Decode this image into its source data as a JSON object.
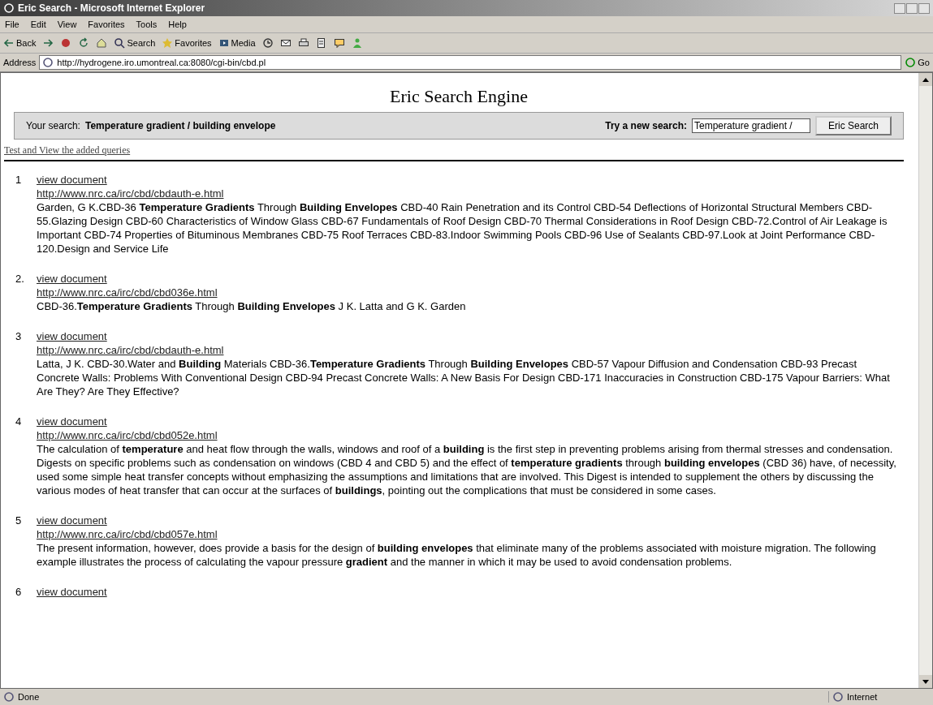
{
  "window": {
    "title": "Eric Search - Microsoft Internet Explorer"
  },
  "menu": [
    "File",
    "Edit",
    "View",
    "Favorites",
    "Tools",
    "Help"
  ],
  "toolbar": [
    {
      "kind": "back",
      "label": "Back"
    },
    {
      "kind": "forward"
    },
    {
      "kind": "stop"
    },
    {
      "kind": "refresh"
    },
    {
      "kind": "home"
    },
    {
      "kind": "search",
      "label": "Search"
    },
    {
      "kind": "favorites",
      "label": "Favorites"
    },
    {
      "kind": "media",
      "label": "Media"
    },
    {
      "kind": "history"
    },
    {
      "kind": "mail"
    },
    {
      "kind": "print"
    },
    {
      "kind": "edit"
    },
    {
      "kind": "discuss"
    },
    {
      "kind": "messenger"
    }
  ],
  "address": {
    "label": "Address",
    "value": "http://hydrogene.iro.umontreal.ca:8080/cgi-bin/cbd.pl",
    "go": "Go"
  },
  "page": {
    "heading": "Eric Search Engine",
    "search_bar": {
      "label": "Your search:",
      "query": "Temperature gradient / building envelope",
      "new_label": "Try a new search:",
      "field_value": "Temperature gradient /",
      "button": "Eric Search"
    },
    "test_link": "Test and View the added queries",
    "results": [
      {
        "number": "1",
        "link": "view document",
        "url": "http://www.nrc.ca/irc/cbd/cbdauth-e.html",
        "snippet": "Garden, G K.CBD-36 **Temperature Gradients** Through **Building Envelopes** CBD-40 Rain Penetration and its Control CBD-54 Deflections of Horizontal Structural Members CBD-55.Glazing Design CBD-60 Characteristics of Window Glass CBD-67 Fundamentals of Roof Design CBD-70 Thermal Considerations in Roof Design CBD-72.Control of Air Leakage is Important CBD-74 Properties of Bituminous Membranes CBD-75 Roof Terraces CBD-83.Indoor Swimming Pools CBD-96 Use of Sealants CBD-97.Look at Joint Performance CBD-120.Design and Service Life"
      },
      {
        "number": "2.",
        "link": "view document",
        "url": "http://www.nrc.ca/irc/cbd/cbd036e.html",
        "snippet": "CBD-36.**Temperature Gradients** Through **Building Envelopes** J K. Latta and G K. Garden"
      },
      {
        "number": "3",
        "link": "view document",
        "url": "http://www.nrc.ca/irc/cbd/cbdauth-e.html",
        "snippet": "Latta, J K. CBD-30.Water and **Building** Materials CBD-36.**Temperature Gradients** Through **Building Envelopes** CBD-57 Vapour Diffusion and Condensation CBD-93 Precast Concrete Walls: Problems With Conventional Design CBD-94 Precast Concrete Walls: A New Basis For Design CBD-171 Inaccuracies in Construction CBD-175 Vapour Barriers: What Are They? Are They Effective?"
      },
      {
        "number": "4",
        "link": "view document",
        "url": "http://www.nrc.ca/irc/cbd/cbd052e.html",
        "snippet": "The calculation of **temperature** and heat flow through the walls, windows and roof of a **building** is the first step in preventing problems arising from thermal stresses and condensation. Digests on specific problems such as condensation on windows (CBD 4 and CBD 5) and the effect of **temperature gradients** through **building envelopes** (CBD 36) have, of necessity, used some simple heat transfer concepts without emphasizing the assumptions and limitations that are involved. This Digest is intended to supplement the others by discussing the various modes of heat transfer that can occur at the surfaces of **buildings**, pointing out the complications that must be considered in some cases."
      },
      {
        "number": "5",
        "link": "view document",
        "url": "http://www.nrc.ca/irc/cbd/cbd057e.html",
        "snippet": "The present information, however, does provide a basis for the design of **building envelopes** that eliminate many of the problems associated with moisture migration. The following example illustrates the process of calculating the vapour pressure **gradient** and the manner in which it may be used to avoid condensation problems."
      },
      {
        "number": "6",
        "link": "view document"
      }
    ]
  },
  "status_bar": {
    "text": "Done",
    "zone": "Internet"
  }
}
